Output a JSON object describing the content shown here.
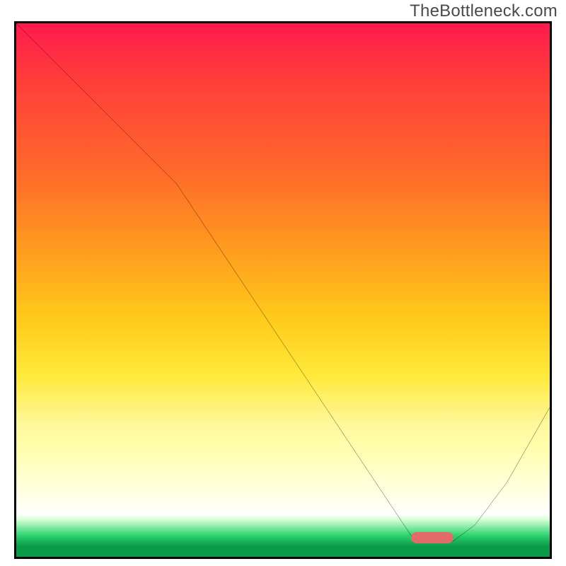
{
  "watermark": "TheBottleneck.com",
  "chart_data": {
    "type": "line",
    "title": "",
    "xlabel": "",
    "ylabel": "",
    "xlim": [
      0,
      100
    ],
    "ylim": [
      0,
      100
    ],
    "grid": false,
    "annotations": [
      {
        "type": "marker",
        "shape": "pill",
        "color": "#e26a6a",
        "x": 78,
        "y": 3
      }
    ],
    "background_gradient": {
      "direction": "vertical",
      "stops": [
        {
          "pos": 0,
          "color": "#ff1a4d"
        },
        {
          "pos": 28,
          "color": "#ff6a2a"
        },
        {
          "pos": 55,
          "color": "#ffc91a"
        },
        {
          "pos": 75,
          "color": "#fff79a"
        },
        {
          "pos": 92,
          "color": "#ffffff"
        },
        {
          "pos": 96,
          "color": "#2dd36f"
        },
        {
          "pos": 100,
          "color": "#0a9a4a"
        }
      ]
    },
    "series": [
      {
        "name": "bottleneck-curve",
        "x": [
          0,
          8,
          16,
          24,
          30,
          38,
          46,
          54,
          62,
          70,
          74,
          78,
          82,
          86,
          92,
          100
        ],
        "y": [
          100,
          92,
          84,
          76,
          70,
          58,
          46,
          34,
          22,
          10,
          4,
          3,
          3,
          6,
          14,
          28
        ]
      }
    ]
  },
  "marker": {
    "left_pct": 74,
    "bottom_pct": 2.5,
    "width_pct": 8,
    "height_pct": 2.1
  }
}
